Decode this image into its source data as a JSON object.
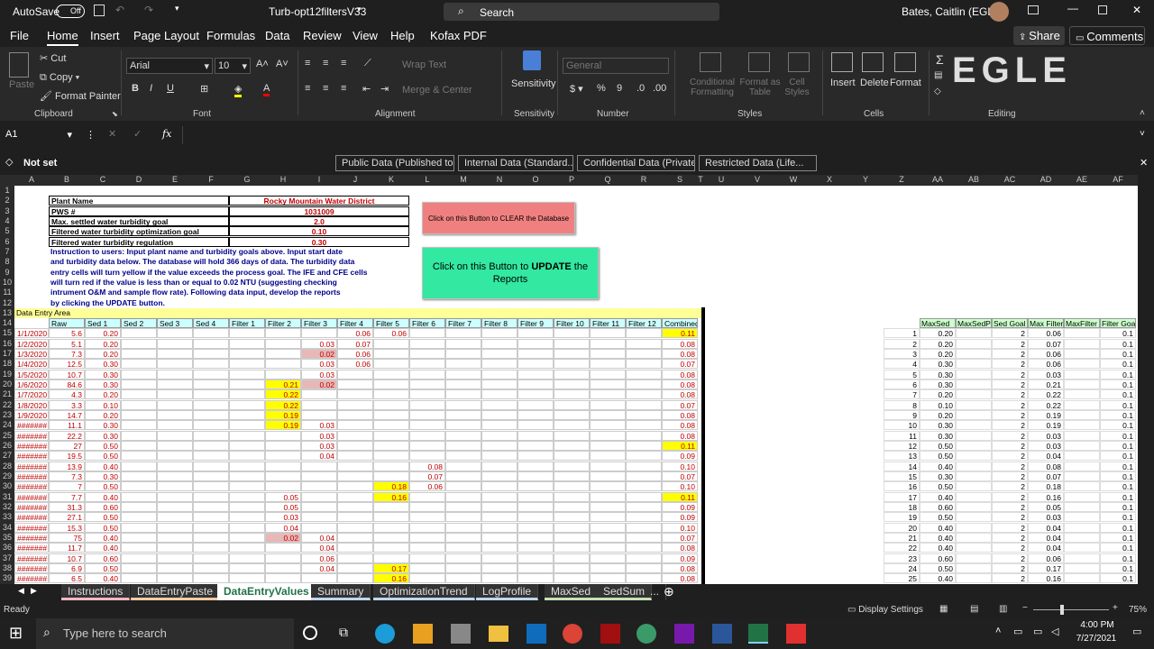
{
  "title": {
    "autosave": "AutoSave",
    "toggle": "Off",
    "filename": "Turb-opt12filtersV33",
    "search": "Search",
    "user": "Bates, Caitlin (EGLE)"
  },
  "menu": {
    "file": "File",
    "home": "Home",
    "insert": "Insert",
    "pagelayout": "Page Layout",
    "formulas": "Formulas",
    "data": "Data",
    "review": "Review",
    "view": "View",
    "help": "Help",
    "kofax": "Kofax PDF",
    "share": "Share",
    "comments": "Comments"
  },
  "ribbon": {
    "cut": "Cut",
    "copy": "Copy",
    "painter": "Format Painter",
    "paste": "Paste",
    "clipboard": "Clipboard",
    "font": "Arial",
    "size": "10",
    "fontgroup": "Font",
    "wrap": "Wrap Text",
    "merge": "Merge & Center",
    "alignment": "Alignment",
    "sensitivity": "Sensitivity",
    "numberformat": "General",
    "number": "Number",
    "condfmt": "Conditional Formatting",
    "fmtable": "Format as Table",
    "cellstyles": "Cell Styles",
    "styles": "Styles",
    "insert": "Insert",
    "delete": "Delete",
    "format": "Format",
    "cells": "Cells",
    "editing": "Editing",
    "logo": "EGLE"
  },
  "formula": {
    "namebox": "A1",
    "fx": "fx",
    "value": ""
  },
  "sens": {
    "notset": "Not set",
    "b1": "Public Data (Published to...",
    "b2": "Internal Data (Standard...",
    "b3": "Confidential Data (Private)",
    "b4": "Restricted Data (Life..."
  },
  "cols": [
    "A",
    "B",
    "C",
    "D",
    "E",
    "F",
    "G",
    "H",
    "I",
    "J",
    "K",
    "L",
    "M",
    "N",
    "O",
    "P",
    "Q",
    "R",
    "S",
    "T",
    "U",
    "V",
    "W",
    "X",
    "Y",
    "Z",
    "AA",
    "AB",
    "AC",
    "AD",
    "AE",
    "AF"
  ],
  "rows": [
    "1",
    "2",
    "3",
    "4",
    "5",
    "6",
    "7",
    "8",
    "9",
    "10",
    "11",
    "12",
    "13",
    "14",
    "15",
    "16",
    "17",
    "18",
    "19",
    "20",
    "21",
    "22",
    "23",
    "24",
    "25",
    "26",
    "27",
    "28",
    "29",
    "30",
    "31",
    "32",
    "33",
    "34",
    "35",
    "36",
    "37",
    "38",
    "39"
  ],
  "info": {
    "plant_label": "Plant Name",
    "plant": "Rocky Mountain Water District",
    "pws_label": "PWS #",
    "pws": "1031009",
    "sed_label": "Max. settled water turbidity goal",
    "sed": "2.0",
    "filt_label": "Filtered water turbidity optimization goal",
    "filt": "0.10",
    "reg_label": "Filtered water turbidity regulation",
    "reg": "0.30"
  },
  "instructions": [
    "Instruction to users:  Input plant name and turbidity goals above.  Input start date",
    "and turbidity data below.  The database will hold 366 days of data.  The turbidity data",
    "entry cells will turn yellow if the value exceeds the process goal.  The IFE and CFE cells",
    "will turn red if the value is less than or equal to 0.02 NTU (suggesting checking",
    "intrument O&M and sample flow rate).  Following data input, develop the reports",
    "by clicking the UPDATE button."
  ],
  "buttons": {
    "clear": "Click on this Button to CLEAR the Database",
    "update_pre": "Click on this Button to ",
    "update_bold": "UPDATE",
    "update_post": " the Reports"
  },
  "area_label": "Data Entry Area",
  "headers": [
    "Raw",
    "Sed 1",
    "Sed 2",
    "Sed 3",
    "Sed 4",
    "Filter 1",
    "Filter 2",
    "Filter 3",
    "Filter 4",
    "Filter 5",
    "Filter 6",
    "Filter 7",
    "Filter 8",
    "Filter 9",
    "Filter 10",
    "Filter 11",
    "Filter 12",
    "Combined"
  ],
  "right_headers": [
    "MaxSed",
    "MaxSedP",
    "Sed Goal",
    "Max Filter",
    "MaxFilter",
    "Filter Goal"
  ],
  "data": [
    [
      "1/1/2020",
      "5.6",
      "0.20",
      "",
      "",
      "",
      "",
      "",
      "",
      "0.06",
      "0.06",
      "",
      "",
      "",
      "",
      "",
      "",
      "",
      "0.11"
    ],
    [
      "1/2/2020",
      "5.1",
      "0.20",
      "",
      "",
      "",
      "",
      "",
      "0.03",
      "0.07",
      "",
      "",
      "",
      "",
      "",
      "",
      "",
      "",
      "0.08"
    ],
    [
      "1/3/2020",
      "7.3",
      "0.20",
      "",
      "",
      "",
      "",
      "",
      "0.02",
      "0.06",
      "",
      "",
      "",
      "",
      "",
      "",
      "",
      "",
      "0.08"
    ],
    [
      "1/4/2020",
      "12.5",
      "0.30",
      "",
      "",
      "",
      "",
      "",
      "0.03",
      "0.06",
      "",
      "",
      "",
      "",
      "",
      "",
      "",
      "",
      "0.07"
    ],
    [
      "1/5/2020",
      "10.7",
      "0.30",
      "",
      "",
      "",
      "",
      "",
      "0.03",
      "",
      "",
      "",
      "",
      "",
      "",
      "",
      "",
      "",
      "0.08"
    ],
    [
      "1/6/2020",
      "84.6",
      "0.30",
      "",
      "",
      "",
      "",
      "0.21",
      "0.02",
      "",
      "",
      "",
      "",
      "",
      "",
      "",
      "",
      "",
      "0.08"
    ],
    [
      "1/7/2020",
      "4.3",
      "0.20",
      "",
      "",
      "",
      "",
      "0.22",
      "",
      "",
      "",
      "",
      "",
      "",
      "",
      "",
      "",
      "",
      "0.08"
    ],
    [
      "1/8/2020",
      "3.3",
      "0.10",
      "",
      "",
      "",
      "",
      "0.22",
      "",
      "",
      "",
      "",
      "",
      "",
      "",
      "",
      "",
      "",
      "0.07"
    ],
    [
      "1/9/2020",
      "14.7",
      "0.20",
      "",
      "",
      "",
      "",
      "0.19",
      "",
      "",
      "",
      "",
      "",
      "",
      "",
      "",
      "",
      "",
      "0.08"
    ],
    [
      "#######",
      "11.1",
      "0.30",
      "",
      "",
      "",
      "",
      "0.19",
      "0.03",
      "",
      "",
      "",
      "",
      "",
      "",
      "",
      "",
      "",
      "0.08"
    ],
    [
      "#######",
      "22.2",
      "0.30",
      "",
      "",
      "",
      "",
      "",
      "0.03",
      "",
      "",
      "",
      "",
      "",
      "",
      "",
      "",
      "",
      "0.08"
    ],
    [
      "#######",
      "27",
      "0.50",
      "",
      "",
      "",
      "",
      "",
      "0.03",
      "",
      "",
      "",
      "",
      "",
      "",
      "",
      "",
      "",
      "0.11"
    ],
    [
      "#######",
      "19.5",
      "0.50",
      "",
      "",
      "",
      "",
      "",
      "0.04",
      "",
      "",
      "",
      "",
      "",
      "",
      "",
      "",
      "",
      "0.09"
    ],
    [
      "#######",
      "13.9",
      "0.40",
      "",
      "",
      "",
      "",
      "",
      "",
      "",
      "",
      "0.08",
      "",
      "",
      "",
      "",
      "",
      "",
      "0.10"
    ],
    [
      "#######",
      "7.3",
      "0.30",
      "",
      "",
      "",
      "",
      "",
      "",
      "",
      "",
      "0.07",
      "",
      "",
      "",
      "",
      "",
      "",
      "0.07"
    ],
    [
      "#######",
      "7",
      "0.50",
      "",
      "",
      "",
      "",
      "",
      "",
      "",
      "0.18",
      "0.06",
      "",
      "",
      "",
      "",
      "",
      "",
      "0.10"
    ],
    [
      "#######",
      "7.7",
      "0.40",
      "",
      "",
      "",
      "",
      "0.05",
      "",
      "",
      "0.16",
      "",
      "",
      "",
      "",
      "",
      "",
      "",
      "0.11"
    ],
    [
      "#######",
      "31.3",
      "0.60",
      "",
      "",
      "",
      "",
      "0.05",
      "",
      "",
      "",
      "",
      "",
      "",
      "",
      "",
      "",
      "",
      "0.09"
    ],
    [
      "#######",
      "27.1",
      "0.50",
      "",
      "",
      "",
      "",
      "0.03",
      "",
      "",
      "",
      "",
      "",
      "",
      "",
      "",
      "",
      "",
      "0.09"
    ],
    [
      "#######",
      "15.3",
      "0.50",
      "",
      "",
      "",
      "",
      "0.04",
      "",
      "",
      "",
      "",
      "",
      "",
      "",
      "",
      "",
      "",
      "0.10"
    ],
    [
      "#######",
      "75",
      "0.40",
      "",
      "",
      "",
      "",
      "0.02",
      "0.04",
      "",
      "",
      "",
      "",
      "",
      "",
      "",
      "",
      "",
      "0.07"
    ],
    [
      "#######",
      "11.7",
      "0.40",
      "",
      "",
      "",
      "",
      "",
      "0.04",
      "",
      "",
      "",
      "",
      "",
      "",
      "",
      "",
      "",
      "0.08"
    ],
    [
      "#######",
      "10.7",
      "0.60",
      "",
      "",
      "",
      "",
      "",
      "0.06",
      "",
      "",
      "",
      "",
      "",
      "",
      "",
      "",
      "",
      "0.09"
    ],
    [
      "#######",
      "6.9",
      "0.50",
      "",
      "",
      "",
      "",
      "",
      "0.04",
      "",
      "0.17",
      "",
      "",
      "",
      "",
      "",
      "",
      "",
      "0.08"
    ],
    [
      "#######",
      "6.5",
      "0.40",
      "",
      "",
      "",
      "",
      "",
      "",
      "",
      "0.16",
      "",
      "",
      "",
      "",
      "",
      "",
      "",
      "0.08"
    ]
  ],
  "right_data": [
    [
      "1",
      "0.20",
      "",
      "2",
      "0.06",
      "",
      "0.1"
    ],
    [
      "2",
      "0.20",
      "",
      "2",
      "0.07",
      "",
      "0.1"
    ],
    [
      "3",
      "0.20",
      "",
      "2",
      "0.06",
      "",
      "0.1"
    ],
    [
      "4",
      "0.30",
      "",
      "2",
      "0.06",
      "",
      "0.1"
    ],
    [
      "5",
      "0.30",
      "",
      "2",
      "0.03",
      "",
      "0.1"
    ],
    [
      "6",
      "0.30",
      "",
      "2",
      "0.21",
      "",
      "0.1"
    ],
    [
      "7",
      "0.20",
      "",
      "2",
      "0.22",
      "",
      "0.1"
    ],
    [
      "8",
      "0.10",
      "",
      "2",
      "0.22",
      "",
      "0.1"
    ],
    [
      "9",
      "0.20",
      "",
      "2",
      "0.19",
      "",
      "0.1"
    ],
    [
      "10",
      "0.30",
      "",
      "2",
      "0.19",
      "",
      "0.1"
    ],
    [
      "11",
      "0.30",
      "",
      "2",
      "0.03",
      "",
      "0.1"
    ],
    [
      "12",
      "0.50",
      "",
      "2",
      "0.03",
      "",
      "0.1"
    ],
    [
      "13",
      "0.50",
      "",
      "2",
      "0.04",
      "",
      "0.1"
    ],
    [
      "14",
      "0.40",
      "",
      "2",
      "0.08",
      "",
      "0.1"
    ],
    [
      "15",
      "0.30",
      "",
      "2",
      "0.07",
      "",
      "0.1"
    ],
    [
      "16",
      "0.50",
      "",
      "2",
      "0.18",
      "",
      "0.1"
    ],
    [
      "17",
      "0.40",
      "",
      "2",
      "0.16",
      "",
      "0.1"
    ],
    [
      "18",
      "0.60",
      "",
      "2",
      "0.05",
      "",
      "0.1"
    ],
    [
      "19",
      "0.50",
      "",
      "2",
      "0.03",
      "",
      "0.1"
    ],
    [
      "20",
      "0.40",
      "",
      "2",
      "0.04",
      "",
      "0.1"
    ],
    [
      "21",
      "0.40",
      "",
      "2",
      "0.04",
      "",
      "0.1"
    ],
    [
      "22",
      "0.40",
      "",
      "2",
      "0.04",
      "",
      "0.1"
    ],
    [
      "23",
      "0.60",
      "",
      "2",
      "0.06",
      "",
      "0.1"
    ],
    [
      "24",
      "0.50",
      "",
      "2",
      "0.17",
      "",
      "0.1"
    ],
    [
      "25",
      "0.40",
      "",
      "2",
      "0.16",
      "",
      "0.1"
    ]
  ],
  "tabs": [
    "Instructions",
    "DataEntryPaste",
    "DataEntryValues",
    "Summary",
    "OptimizationTrend",
    "LogProfile",
    "MaxSed",
    "SedSum",
    "..."
  ],
  "status": {
    "ready": "Ready",
    "display": "Display Settings",
    "zoom": "75%"
  },
  "taskbar": {
    "search": "Type here to search",
    "time": "4:00 PM",
    "date": "7/27/2021"
  },
  "colors": {
    "yellow": "#ffff00",
    "red": "#e6b8b7",
    "green": "#33e8a0",
    "pink": "#f08080",
    "datatext": "#c00000",
    "infotext": "#c00000",
    "instr": "#00008b"
  }
}
